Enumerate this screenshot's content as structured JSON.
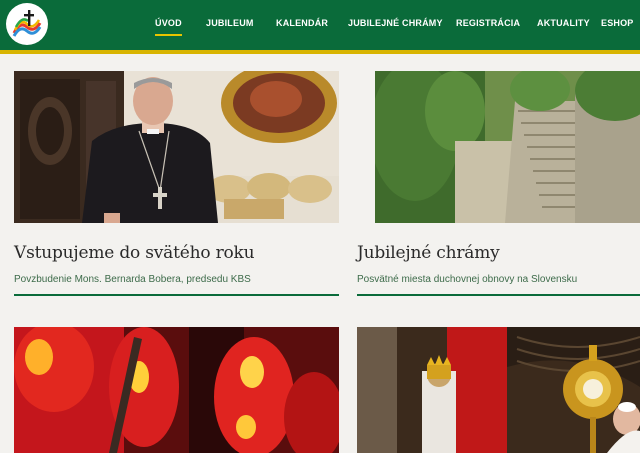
{
  "nav": {
    "items": [
      {
        "label": "ÚVOD",
        "active": true
      },
      {
        "label": "JUBILEUM",
        "active": false
      },
      {
        "label": "KALENDÁR",
        "active": false
      },
      {
        "label": "JUBILEJNÉ CHRÁMY",
        "active": false
      },
      {
        "label": "REGISTRÁCIA",
        "active": false
      },
      {
        "label": "AKTUALITY",
        "active": false
      },
      {
        "label": "ESHOP",
        "active": false
      }
    ]
  },
  "cards": [
    {
      "title": "Vstupujeme do svätého roku",
      "subtitle": "Povzbudenie Mons. Bernarda Bobera, predsedu KBS"
    },
    {
      "title": "Jubilejné chrámy",
      "subtitle": "Posvätné miesta duchovnej obnovy na Slovensku"
    }
  ],
  "colors": {
    "header": "#0a6b3a",
    "accent": "#d8b400",
    "rule": "#0a6b3a"
  }
}
